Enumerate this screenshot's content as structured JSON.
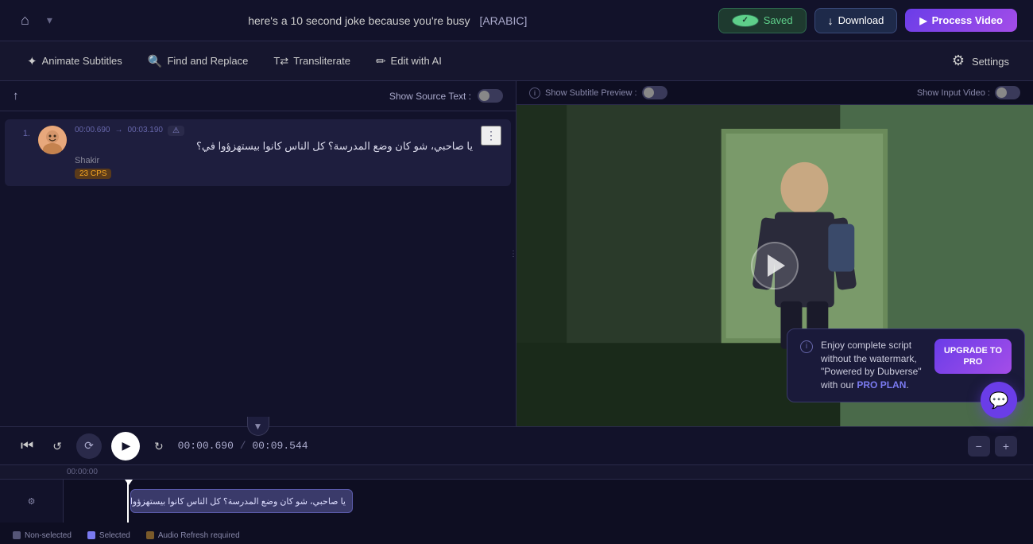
{
  "header": {
    "title": "here's a 10 second joke because you're busy",
    "title_arabic": "[ARABIC]",
    "saved_label": "Saved",
    "download_label": "Download",
    "process_label": "Process Video"
  },
  "toolbar": {
    "animate_subtitles_label": "Animate Subtitles",
    "find_replace_label": "Find and Replace",
    "transliterate_label": "Transliterate",
    "edit_with_ai_label": "Edit with AI",
    "settings_label": "Settings"
  },
  "subtitle_editor": {
    "show_source_text_label": "Show Source Text :",
    "items": [
      {
        "number": "1.",
        "time_start": "00:00.690",
        "time_end": "00:03.190",
        "text": "يا صاحبي، شو كان وضع المدرسة؟ كل الناس كانوا بيستهزؤوا في؟",
        "speaker": "Shakir",
        "info_badge": "23 CPS",
        "has_fps": true
      }
    ]
  },
  "video_panel": {
    "show_subtitle_preview_label": "Show Subtitle Preview :",
    "show_input_video_label": "Show Input Video :",
    "subtitle_text": "يا صاحبي، شو كان وضع المدرسة؟ كل الناس كانوا بيستهزؤوا في؟"
  },
  "upgrade_banner": {
    "info_text": "Enjoy complete script without the watermark, \"Powered by Dubverse\" with our",
    "pro_plan_label": "PRO PLAN",
    "period": ".",
    "button_line1": "UPGRADE TO",
    "button_line2": "PRO"
  },
  "playback": {
    "time_current": "00:00.690",
    "time_separator": "/",
    "time_total": "00:09.544"
  },
  "timeline": {
    "timestamp_label": "00:00:00",
    "subtitle_block_text": "يا صاحبي، شو كان وضع المدرسة؟ كل الناس كانوا بيستهزؤوا في؟"
  },
  "legend": {
    "items": [
      {
        "label": "Non-selected",
        "color": "#555577"
      },
      {
        "label": "Selected",
        "color": "#7a7af0"
      },
      {
        "label": "Audio Refresh required",
        "color": "#7a5a2a"
      }
    ]
  },
  "icons": {
    "home": "⌂",
    "chevron_down": "▾",
    "animate": "✦",
    "search": "🔍",
    "transliterate": "T↔",
    "edit_ai": "✏",
    "settings": "⚙",
    "download_arrow": "↓",
    "play_circle": "▶",
    "process_arrow": "▶",
    "check": "✓",
    "info": "i",
    "rewind": "⏮",
    "back5": "↺",
    "fwd5": "↻",
    "play": "▶",
    "sync": "⟳",
    "zoom_out": "−",
    "zoom_in": "+",
    "export": "↑",
    "three_dots": "⋮",
    "chat": "💬",
    "collapse_down": "▼"
  }
}
